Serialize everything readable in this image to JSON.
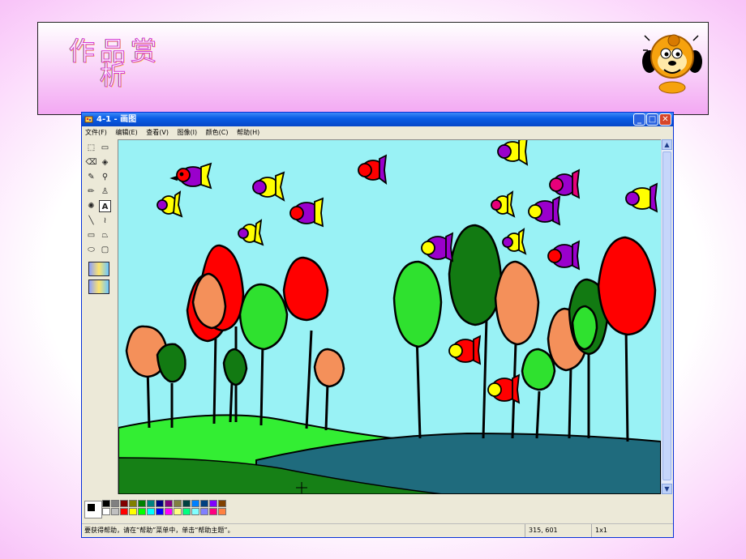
{
  "slide": {
    "title": "作品赏\n析"
  },
  "window": {
    "title": "4-1 - 画图",
    "buttons": {
      "minimize": "_",
      "maximize": "□",
      "close": "✕"
    }
  },
  "menu": [
    "文件(F)",
    "编辑(E)",
    "查看(V)",
    "图像(I)",
    "颜色(C)",
    "帮助(H)"
  ],
  "toolbox": {
    "tools": [
      {
        "name": "free-select",
        "glyph": "⬚"
      },
      {
        "name": "rect-select",
        "glyph": "▭"
      },
      {
        "name": "eraser",
        "glyph": "⌫"
      },
      {
        "name": "fill",
        "glyph": "◈"
      },
      {
        "name": "color-picker",
        "glyph": "✎"
      },
      {
        "name": "magnifier",
        "glyph": "⚲"
      },
      {
        "name": "pencil",
        "glyph": "✏"
      },
      {
        "name": "brush",
        "glyph": "♙"
      },
      {
        "name": "airbrush",
        "glyph": "✺"
      },
      {
        "name": "text",
        "glyph": "A"
      },
      {
        "name": "line",
        "glyph": "╲"
      },
      {
        "name": "curve",
        "glyph": "≀"
      },
      {
        "name": "rectangle",
        "glyph": "▭"
      },
      {
        "name": "polygon",
        "glyph": "⏢"
      },
      {
        "name": "ellipse",
        "glyph": "⬭"
      },
      {
        "name": "rounded-rect",
        "glyph": "▢"
      }
    ]
  },
  "palette": {
    "top": [
      "#000000",
      "#808080",
      "#800000",
      "#808000",
      "#008000",
      "#008080",
      "#000080",
      "#800080",
      "#808040",
      "#004040",
      "#0080ff",
      "#004080",
      "#8000ff",
      "#804000"
    ],
    "bottom": [
      "#ffffff",
      "#c0c0c0",
      "#ff0000",
      "#ffff00",
      "#00ff00",
      "#00ffff",
      "#0000ff",
      "#ff00ff",
      "#ffff80",
      "#00ff80",
      "#80ffff",
      "#8080ff",
      "#ff0080",
      "#ff8040"
    ],
    "foreground": "#000000",
    "background": "#ffffff"
  },
  "status": {
    "help": "要获得帮助，请在“帮助”菜单中，单击“帮助主题”。",
    "coords": "315, 601",
    "size": "1x1"
  },
  "painting": {
    "colors": {
      "sky": "#99f2f5",
      "yellow": "#ffff00",
      "purple": "#9a00cc",
      "red": "#ff0000",
      "magenta": "#e6007a",
      "orange": "#f4905a",
      "lightgreen": "#2fe12f",
      "darkgreen": "#127a12",
      "teal": "#1f6b7d",
      "hill-light": "#33ee33",
      "hill-dark": "#168016"
    }
  }
}
